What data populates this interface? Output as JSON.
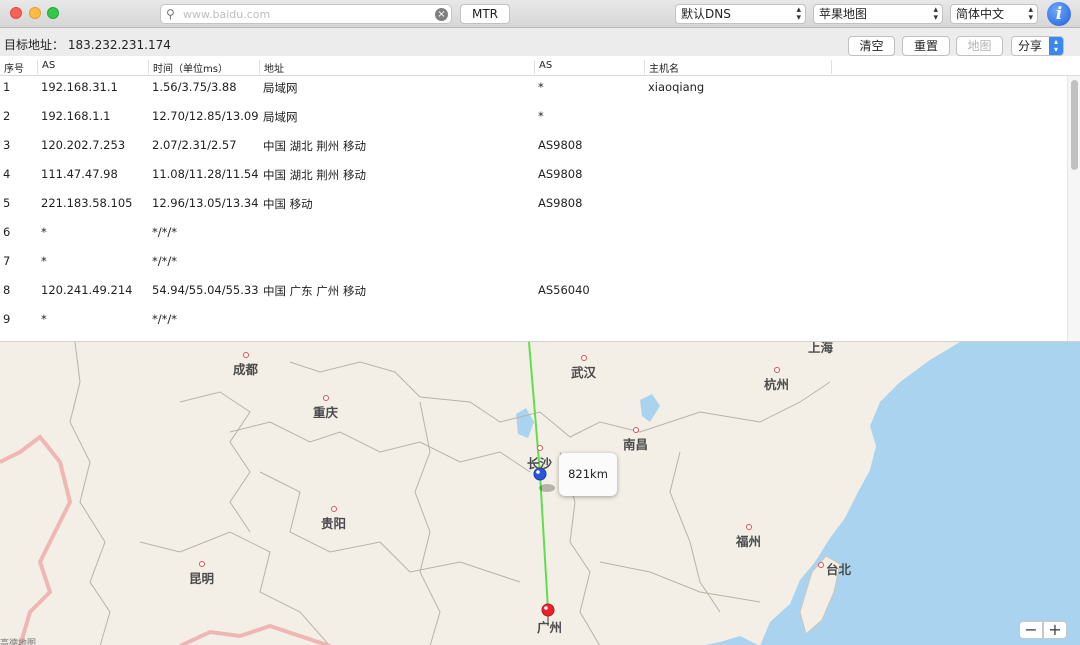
{
  "toolbar": {
    "search_placeholder": "www.baidu.com",
    "mtr_label": "MTR",
    "dns_select": "默认DNS",
    "map_select": "苹果地图",
    "lang_select": "简体中文",
    "info_label": "i"
  },
  "target": {
    "label": "目标地址：",
    "address": "183.232.231.174"
  },
  "actions": {
    "clear": "清空",
    "reset": "重置",
    "map": "地图",
    "share": "分享"
  },
  "table": {
    "headers": [
      "序号",
      "AS",
      "时间（单位ms）",
      "地址",
      "AS",
      "主机名"
    ],
    "rows": [
      {
        "num": "1",
        "ip": "192.168.31.1",
        "time": "1.56/3.75/3.88",
        "location": "局域网",
        "as": "*",
        "host": "xiaoqiang"
      },
      {
        "num": "2",
        "ip": "192.168.1.1",
        "time": "12.70/12.85/13.09",
        "location": "局域网",
        "as": "*",
        "host": ""
      },
      {
        "num": "3",
        "ip": "120.202.7.253",
        "time": "2.07/2.31/2.57",
        "location": "中国 湖北 荆州 移动",
        "as": "AS9808",
        "host": ""
      },
      {
        "num": "4",
        "ip": "111.47.47.98",
        "time": "11.08/11.28/11.54",
        "location": "中国 湖北 荆州 移动",
        "as": "AS9808",
        "host": ""
      },
      {
        "num": "5",
        "ip": "221.183.58.105",
        "time": "12.96/13.05/13.34",
        "location": "中国 移动",
        "as": "AS9808",
        "host": ""
      },
      {
        "num": "6",
        "ip": "*",
        "time": "*/*/*",
        "location": "",
        "as": "",
        "host": ""
      },
      {
        "num": "7",
        "ip": "*",
        "time": "*/*/*",
        "location": "",
        "as": "",
        "host": ""
      },
      {
        "num": "8",
        "ip": "120.241.49.214",
        "time": "54.94/55.04/55.33",
        "location": "中国 广东 广州 移动",
        "as": "AS56040",
        "host": ""
      },
      {
        "num": "9",
        "ip": "*",
        "time": "*/*/*",
        "location": "",
        "as": "",
        "host": ""
      }
    ]
  },
  "map": {
    "cities": [
      {
        "name": "成都",
        "key": "chengdu"
      },
      {
        "name": "重庆",
        "key": "chongqing"
      },
      {
        "name": "武汉",
        "key": "wuhan"
      },
      {
        "name": "杭州",
        "key": "hangzhou"
      },
      {
        "name": "上海",
        "key": "shanghai"
      },
      {
        "name": "南昌",
        "key": "nanchang"
      },
      {
        "name": "长沙",
        "key": "changsha"
      },
      {
        "name": "贵阳",
        "key": "guiyang"
      },
      {
        "name": "福州",
        "key": "fuzhou"
      },
      {
        "name": "台北",
        "key": "taipei"
      },
      {
        "name": "昆明",
        "key": "kunming"
      },
      {
        "name": "广州",
        "key": "guangzhou"
      }
    ],
    "distance": "821km",
    "zoom_out": "−",
    "zoom_in": "+",
    "legal": "高德地图",
    "colors": {
      "land": "#f3efe6",
      "sea": "#a9d3ef",
      "route": "#5ee04a",
      "start_pin": "#2a55d8",
      "end_pin": "#e8232a"
    }
  }
}
